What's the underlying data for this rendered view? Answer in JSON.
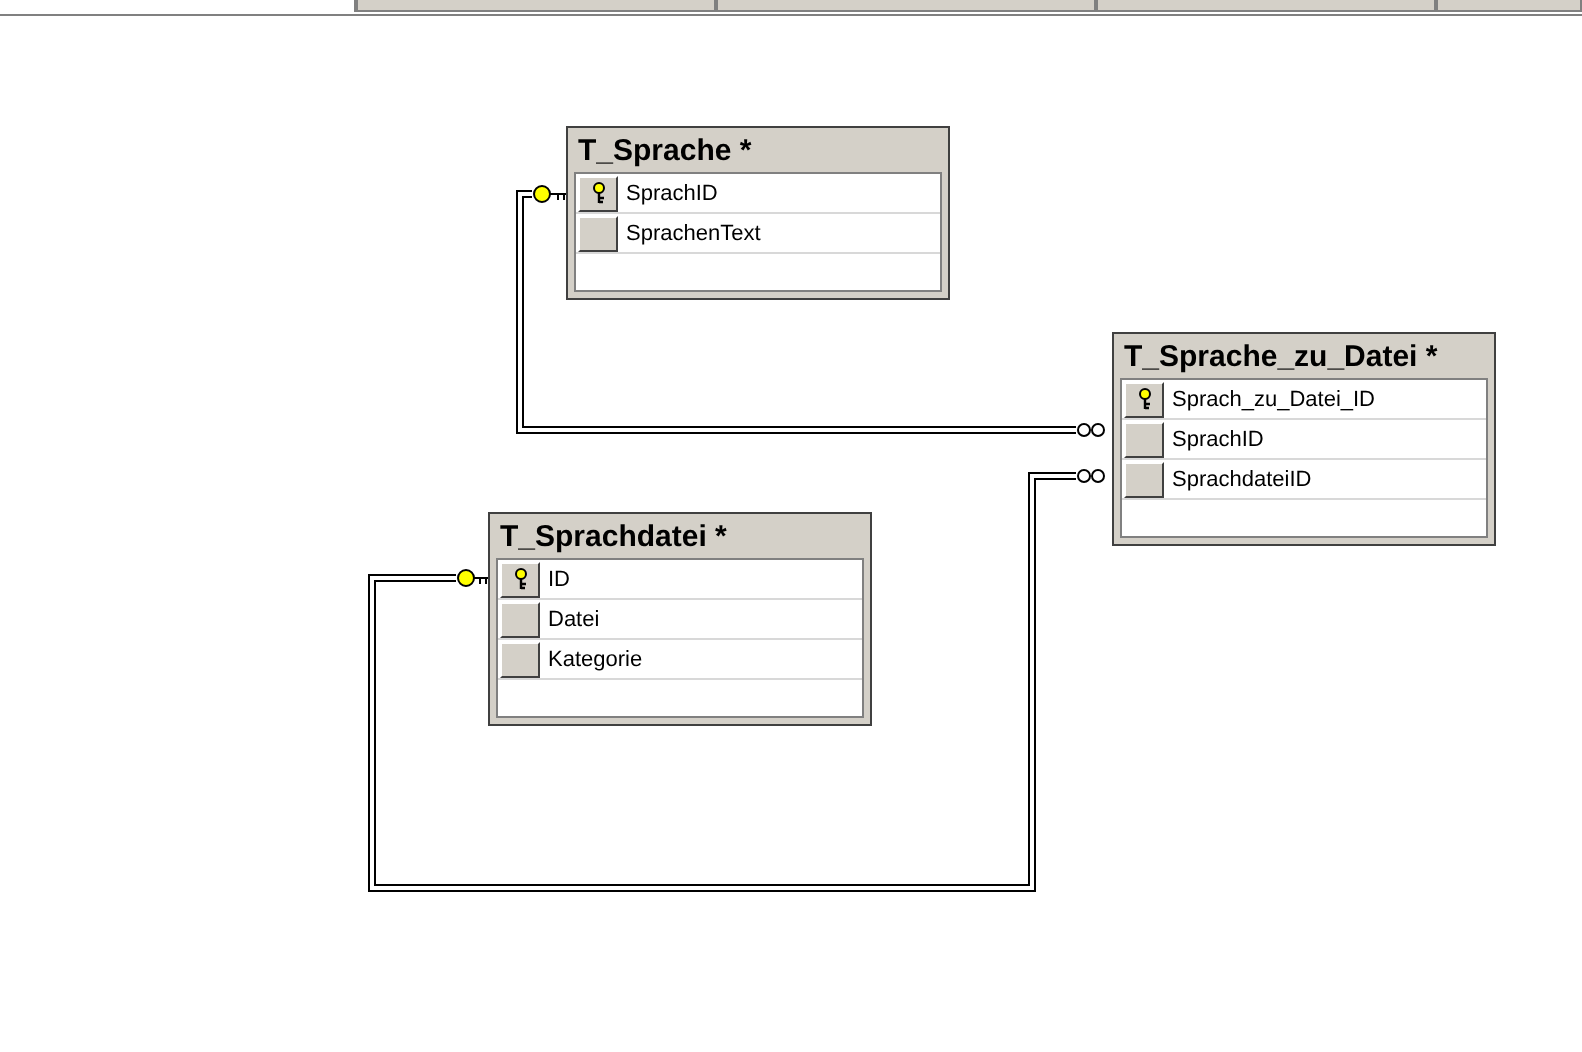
{
  "tabs": [
    {
      "selected": true
    },
    {
      "selected": false
    },
    {
      "selected": false
    },
    {
      "selected": false
    },
    {
      "selected": false
    }
  ],
  "tables": [
    {
      "name": "T_Sprache *",
      "columns": [
        {
          "name": "SprachID",
          "primary_key": true
        },
        {
          "name": "SprachenText",
          "primary_key": false
        }
      ]
    },
    {
      "name": "T_Sprache_zu_Datei *",
      "columns": [
        {
          "name": "Sprach_zu_Datei_ID",
          "primary_key": true
        },
        {
          "name": "SprachID",
          "primary_key": false
        },
        {
          "name": "SprachdateiID",
          "primary_key": false
        }
      ]
    },
    {
      "name": "T_Sprachdatei *",
      "columns": [
        {
          "name": "ID",
          "primary_key": true
        },
        {
          "name": "Datei",
          "primary_key": false
        },
        {
          "name": "Kategorie",
          "primary_key": false
        }
      ]
    }
  ]
}
